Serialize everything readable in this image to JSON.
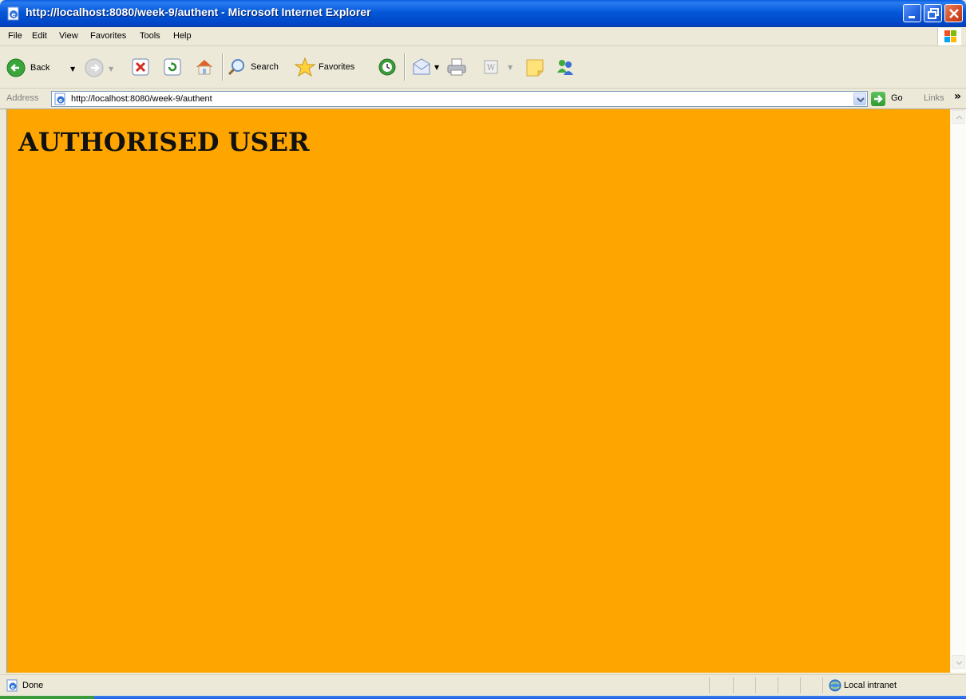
{
  "window": {
    "title": "http://localhost:8080/week-9/authent - Microsoft Internet Explorer"
  },
  "menu": {
    "items": [
      "File",
      "Edit",
      "View",
      "Favorites",
      "Tools",
      "Help"
    ]
  },
  "toolbar": {
    "back_label": "Back",
    "search_label": "Search",
    "favorites_label": "Favorites"
  },
  "address": {
    "label": "Address",
    "url": "http://localhost:8080/week-9/authent",
    "go_label": "Go",
    "links_label": "Links"
  },
  "page": {
    "heading": "AUTHORISED USER",
    "background_color": "#ffa500"
  },
  "status": {
    "text": "Done",
    "zone": "Local intranet"
  }
}
